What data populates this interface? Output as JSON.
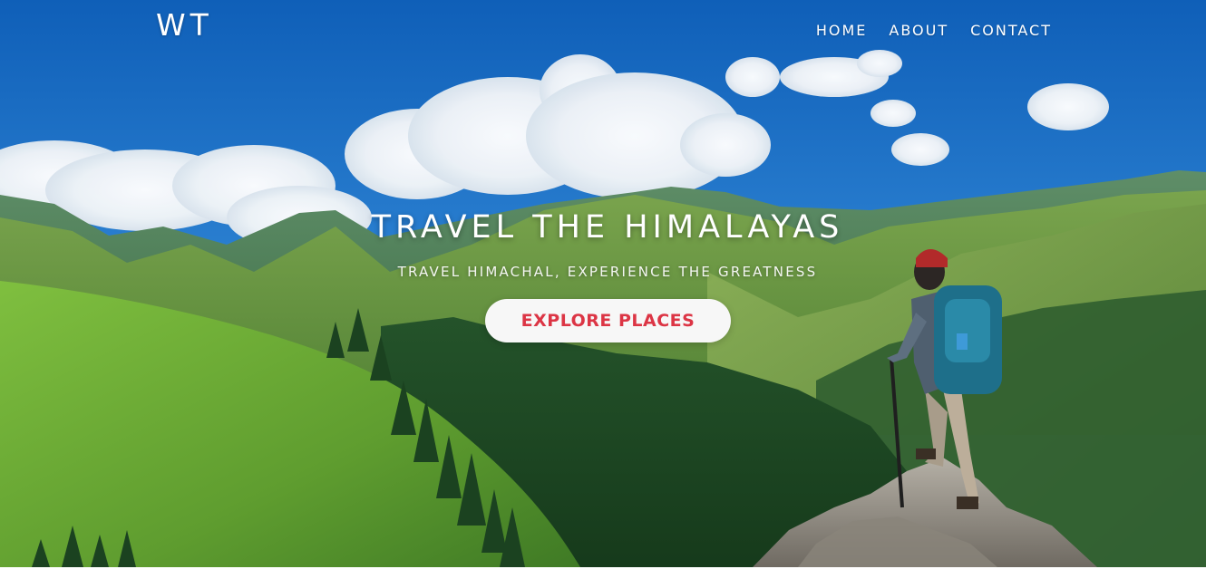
{
  "header": {
    "logo": "WT",
    "nav": [
      {
        "label": "HOME"
      },
      {
        "label": "ABOUT"
      },
      {
        "label": "CONTACT"
      }
    ]
  },
  "hero": {
    "title": "TRAVEL THE HIMALAYAS",
    "subtitle": "TRAVEL HIMACHAL, EXPERIENCE THE GREATNESS",
    "cta_label": "EXPLORE PLACES",
    "background_image": "mountain-hiker-photo",
    "colors": {
      "sky": "#1f6fc4",
      "meadow": "#6aa83a",
      "forest": "#1f4a24",
      "cta_text": "#dc3545",
      "cta_bg": "#f7f7f7"
    }
  }
}
